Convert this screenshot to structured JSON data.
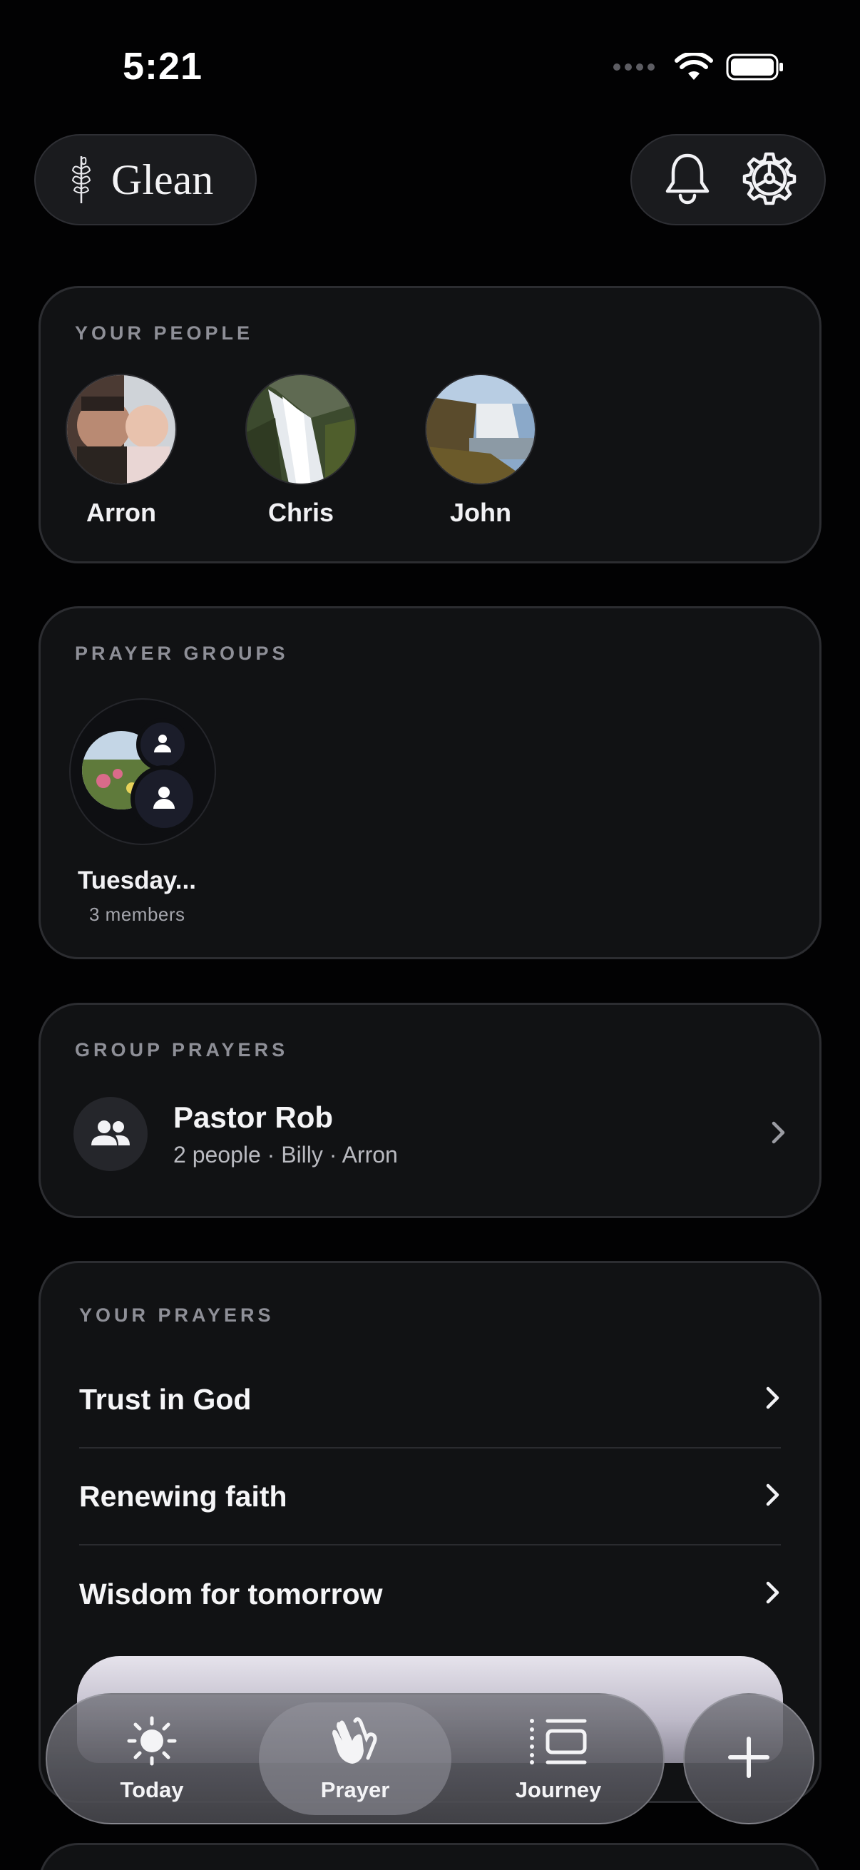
{
  "status_bar": {
    "time": "5:21"
  },
  "header": {
    "app_name": "Glean"
  },
  "your_people": {
    "title": "YOUR PEOPLE",
    "people": [
      {
        "name": "Arron"
      },
      {
        "name": "Chris"
      },
      {
        "name": "John"
      }
    ]
  },
  "prayer_groups": {
    "title": "PRAYER GROUPS",
    "groups": [
      {
        "name": "Tuesday...",
        "members": "3 members"
      }
    ]
  },
  "group_prayers": {
    "title": "GROUP PRAYERS",
    "items": [
      {
        "title": "Pastor Rob",
        "subtitle": "2 people · Billy · Arron"
      }
    ]
  },
  "your_prayers": {
    "title": "YOUR PRAYERS",
    "items": [
      {
        "label": "Trust in God"
      },
      {
        "label": "Renewing faith"
      },
      {
        "label": "Wisdom for tomorrow"
      }
    ]
  },
  "tabbar": {
    "tabs": [
      {
        "label": "Today",
        "icon": "sun-icon"
      },
      {
        "label": "Prayer",
        "icon": "praying-hands-icon",
        "active": true
      },
      {
        "label": "Journey",
        "icon": "timeline-icon"
      }
    ]
  },
  "colors": {
    "background": "#020203",
    "card": "#111214",
    "muted_text": "#8e8f97"
  }
}
